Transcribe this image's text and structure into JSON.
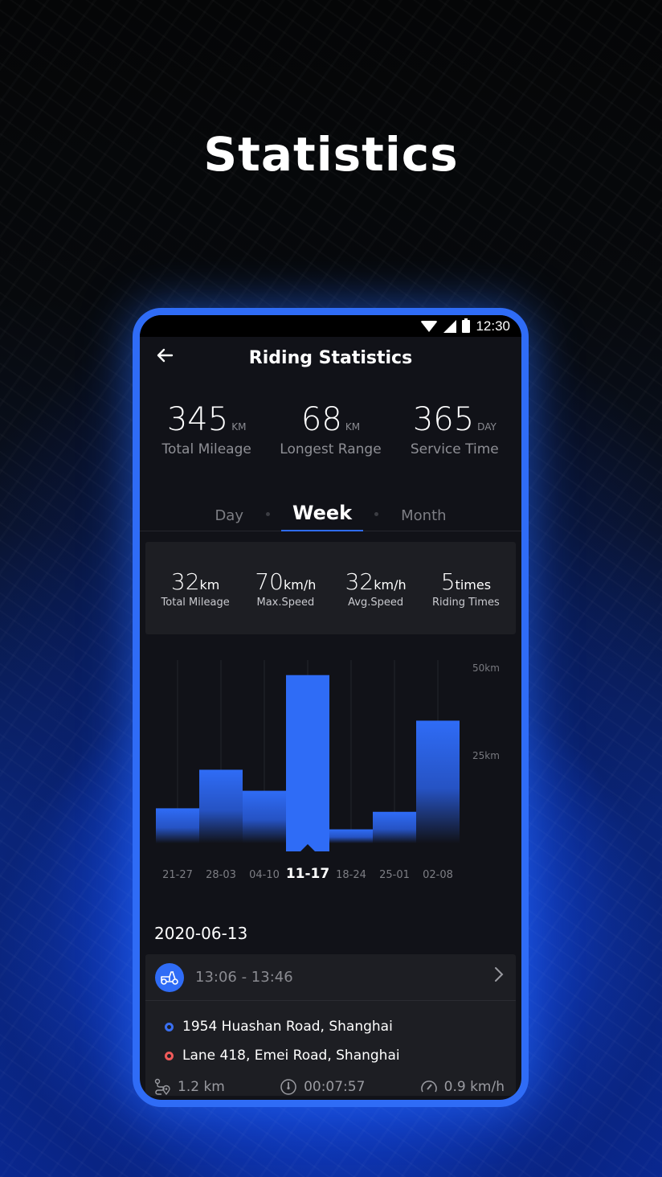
{
  "hero": {
    "title": "Statistics"
  },
  "status_bar": {
    "time": "12:30",
    "icons": [
      "wifi-icon",
      "signal-icon",
      "battery-icon"
    ]
  },
  "header": {
    "back_icon": "arrow-left-icon",
    "title": "Riding Statistics"
  },
  "summary": [
    {
      "value": "345",
      "unit": "KM",
      "label": "Total Mileage"
    },
    {
      "value": "68",
      "unit": "KM",
      "label": "Longest Range"
    },
    {
      "value": "365",
      "unit": "DAY",
      "label": "Service Time"
    }
  ],
  "tabs": [
    {
      "label": "Day",
      "active": false
    },
    {
      "label": "Week",
      "active": true
    },
    {
      "label": "Month",
      "active": false
    }
  ],
  "period_stats": [
    {
      "value": "32",
      "unit": "km",
      "label": "Total Mileage"
    },
    {
      "value": "70",
      "unit": "km/h",
      "label": "Max.Speed"
    },
    {
      "value": "32",
      "unit": "km/h",
      "label": "Avg.Speed"
    },
    {
      "value": "5",
      "unit": "times",
      "label": "Riding Times"
    }
  ],
  "colors": {
    "accent": "#2f6cf6",
    "start_dot": "#3a6ff0",
    "end_dot": "#f05a5a"
  },
  "chart_data": {
    "type": "bar",
    "categories": [
      "21-27",
      "28-03",
      "04-10",
      "11-17",
      "18-24",
      "25-01",
      "02-08"
    ],
    "values": [
      10,
      21,
      15,
      48,
      4,
      9,
      35
    ],
    "selected": "11-17",
    "y_ticks": [
      {
        "value": 50,
        "label": "50km"
      },
      {
        "value": 25,
        "label": "25km"
      }
    ],
    "ylim": [
      0,
      50
    ],
    "ylabel": "km",
    "xlabel": "",
    "title": "",
    "grid": true
  },
  "date": "2020-06-13",
  "trip": {
    "icon": "scooter-icon",
    "time_range": "13:06 - 13:46",
    "start_address": "1954 Huashan Road, Shanghai",
    "end_address": "Lane 418, Emei Road, Shanghai",
    "distance": "1.2 km",
    "duration": "00:07:57",
    "avg_speed": "0.9 km/h"
  }
}
